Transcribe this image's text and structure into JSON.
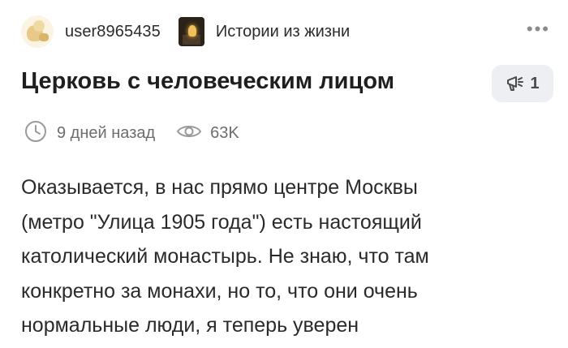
{
  "post": {
    "author": "user8965435",
    "community": "Истории из жизни",
    "more_label": "•••",
    "title": "Церковь с человеческим лицом",
    "comments_count": "1",
    "time_ago": "9 дней назад",
    "views": "63K",
    "body_lines": [
      "Оказывается, в нас прямо центре Москвы",
      "(метро \"Улица 1905 года\") есть настоящий",
      "католический монастырь. Не знаю, что там",
      "конкретно за монахи, но то, что они очень",
      "нормальные люди, я теперь уверен"
    ]
  },
  "colors": {
    "accent_bg": "#eeeff2",
    "muted_text": "#6d6d6d"
  }
}
